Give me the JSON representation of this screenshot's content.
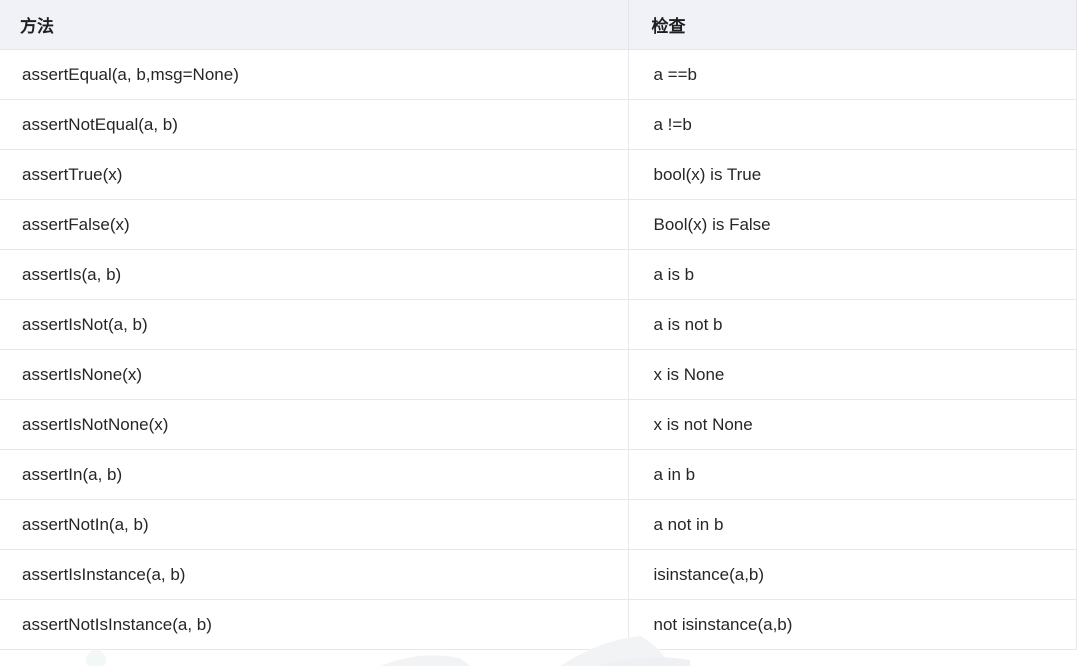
{
  "table": {
    "headers": [
      "方法",
      "检查"
    ],
    "rows": [
      [
        "assertEqual(a, b,msg=None)",
        "a ==b"
      ],
      [
        "assertNotEqual(a, b)",
        "a !=b"
      ],
      [
        "assertTrue(x)",
        "bool(x) is True"
      ],
      [
        "assertFalse(x)",
        "Bool(x) is False"
      ],
      [
        "assertIs(a, b)",
        "a is b"
      ],
      [
        "assertIsNot(a, b)",
        "a is not b"
      ],
      [
        "assertIsNone(x)",
        "x is None"
      ],
      [
        "assertIsNotNone(x)",
        "x is not None"
      ],
      [
        "assertIn(a, b)",
        "a in b"
      ],
      [
        "assertNotIn(a, b)",
        "a not in b"
      ],
      [
        "assertIsInstance(a, b)",
        "isinstance(a,b)"
      ],
      [
        "assertNotIsInstance(a, b)",
        "not isinstance(a,b)"
      ]
    ]
  },
  "colors": {
    "header_bg": "#f0f2f7",
    "border": "#e6e8ec",
    "text": "#262626"
  }
}
